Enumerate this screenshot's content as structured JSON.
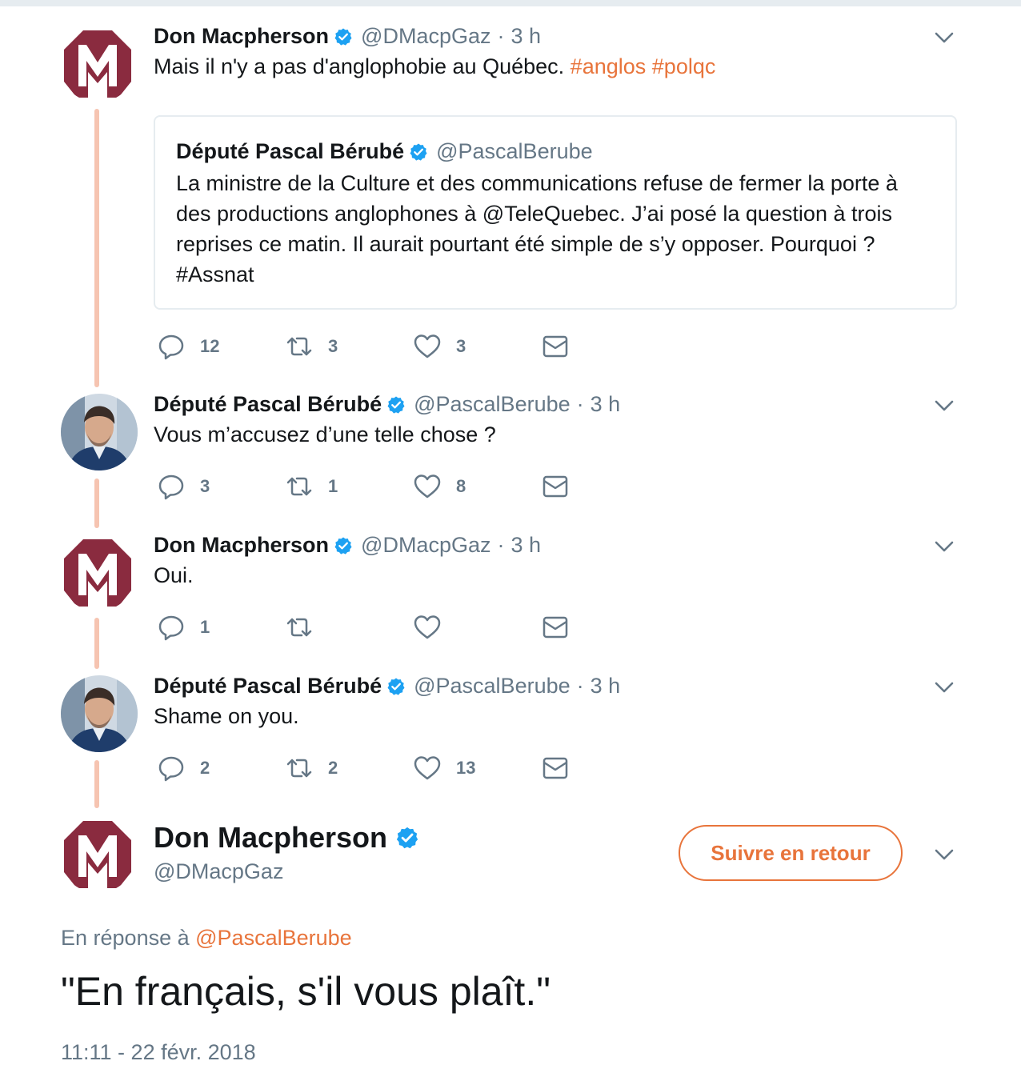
{
  "colors": {
    "accent": "#e8743b",
    "thread_line": "#f6c4b1",
    "verified": "#1da1f2",
    "muted": "#657786",
    "logo": "#8a2b3f"
  },
  "tweets": [
    {
      "author": "Don Macpherson",
      "handle": "@DMacpGaz",
      "separator": "·",
      "time": "3 h",
      "avatar_icon": "logo-m-icon",
      "text": "Mais il n'y a pas d'anglophobie au Québec.",
      "hashtags": [
        "#anglos",
        "#polqc"
      ],
      "quote": {
        "author": "Député Pascal Bérubé",
        "handle": "@PascalBerube",
        "text": "La ministre de la Culture et des communications refuse de fermer la porte à des productions anglophones à @TeleQuebec. J’ai posé la question à trois reprises ce matin. Il aurait pourtant été simple de s’y opposer. Pourquoi ? #Assnat"
      },
      "replies": "12",
      "retweets": "3",
      "likes": "3"
    },
    {
      "author": "Député Pascal Bérubé",
      "handle": "@PascalBerube",
      "separator": "·",
      "time": "3 h",
      "avatar_icon": "user-photo-avatar",
      "text": "Vous m’accusez d’une telle chose ?",
      "replies": "3",
      "retweets": "1",
      "likes": "8"
    },
    {
      "author": "Don Macpherson",
      "handle": "@DMacpGaz",
      "separator": "·",
      "time": "3 h",
      "avatar_icon": "logo-m-icon",
      "text": "Oui.",
      "replies": "1",
      "retweets": "",
      "likes": ""
    },
    {
      "author": "Député Pascal Bérubé",
      "handle": "@PascalBerube",
      "separator": "·",
      "time": "3 h",
      "avatar_icon": "user-photo-avatar",
      "text": "Shame on you.",
      "replies": "2",
      "retweets": "2",
      "likes": "13"
    }
  ],
  "main_tweet": {
    "author": "Don Macpherson",
    "handle": "@DMacpGaz",
    "follow_label": "Suivre en retour",
    "reply_prefix": "En réponse à",
    "reply_to": "@PascalBerube",
    "text": "\"En français, s'il vous plaît.\"",
    "timestamp": "11:11 - 22 févr. 2018"
  }
}
